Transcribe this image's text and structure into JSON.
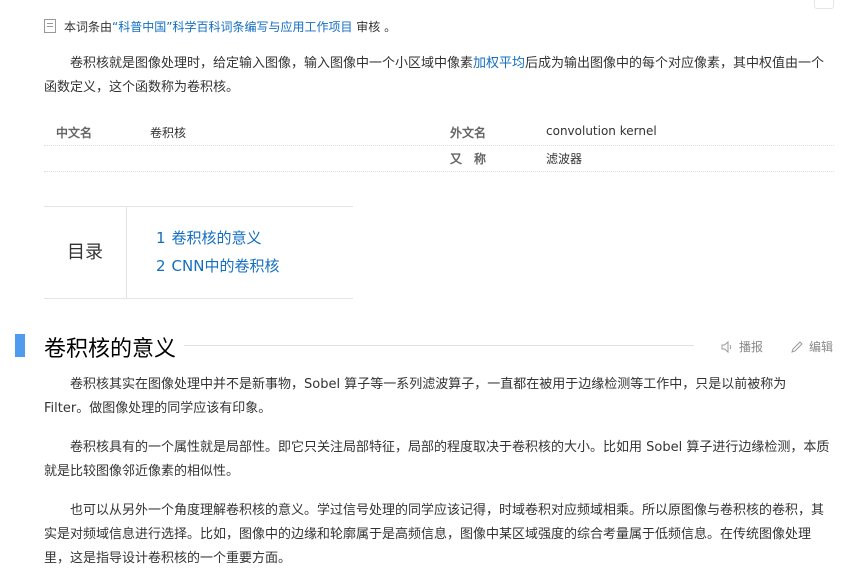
{
  "review_note": {
    "prefix": "本词条由",
    "link": "“科普中国”科学百科词条编写与应用工作项目",
    "suffix": " 审核 。"
  },
  "intro": {
    "before": "卷积核就是图像处理时，给定输入图像，输入图像中一个小区域中像素",
    "link": "加权平均",
    "after": "后成为输出图像中的每个对应像素，其中权值由一个函数定义，这个函数称为卷积核。"
  },
  "basic_info": {
    "label1": "中文名",
    "value1": "卷积核",
    "label2": "外文名",
    "value2": "convolution kernel",
    "label3": "又　称",
    "value3": "滤波器"
  },
  "toc": {
    "label": "目录",
    "items": [
      {
        "num": "1",
        "text": "卷积核的意义"
      },
      {
        "num": "2",
        "text": "CNN中的卷积核"
      }
    ]
  },
  "section": {
    "title": "卷积核的意义",
    "play_label": "播报",
    "edit_label": "编辑"
  },
  "paragraphs": [
    "卷积核其实在图像处理中并不是新事物，Sobel 算子等一系列滤波算子，一直都在被用于边缘检测等工作中，只是以前被称为 Filter。做图像处理的同学应该有印象。",
    "卷积核具有的一个属性就是局部性。即它只关注局部特征，局部的程度取决于卷积核的大小。比如用 Sobel 算子进行边缘检测，本质就是比较图像邻近像素的相似性。",
    "也可以从另外一个角度理解卷积核的意义。学过信号处理的同学应该记得，时域卷积对应频域相乘。所以原图像与卷积核的卷积，其实是对频域信息进行选择。比如，图像中的边缘和轮廓属于是高频信息，图像中某区域强度的综合考量属于低频信息。在传统图像处理里，这是指导设计卷积核的一个重要方面。"
  ],
  "colors": {
    "link": "#136ec2",
    "section_bar": "#4f9cee"
  }
}
